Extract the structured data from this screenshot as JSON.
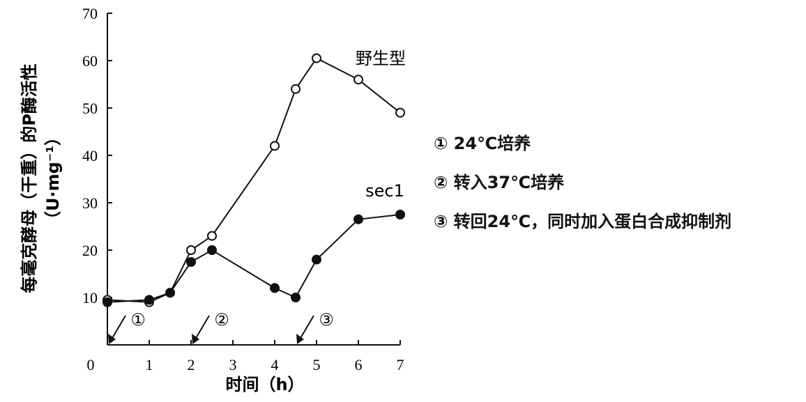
{
  "chart_data": {
    "type": "line",
    "xlabel": "时间（h）",
    "ylabel_line1": "每毫克酵母（干重）的P酶活性",
    "ylabel_line2": "（U·mg⁻¹）",
    "xlim": [
      0,
      7
    ],
    "ylim": [
      0,
      70
    ],
    "x_ticks": [
      "0",
      "1",
      "2",
      "3",
      "4",
      "5",
      "6",
      "7"
    ],
    "y_ticks": [
      "10",
      "20",
      "30",
      "40",
      "50",
      "60",
      "70"
    ],
    "grid": false,
    "series": [
      {
        "name": "野生型",
        "marker": "open-circle",
        "x": [
          0,
          1,
          1.5,
          2,
          2.5,
          4,
          4.5,
          5,
          6,
          7
        ],
        "y": [
          9.5,
          9,
          11,
          20,
          23,
          42,
          54,
          60.5,
          56,
          49
        ]
      },
      {
        "name": "sec1",
        "marker": "filled-circle",
        "x": [
          0,
          1,
          1.5,
          2,
          2.5,
          4,
          4.5,
          5,
          6,
          7
        ],
        "y": [
          9,
          9.5,
          11,
          17.5,
          20,
          12,
          10,
          18,
          26.5,
          27.5
        ]
      }
    ],
    "markers": [
      {
        "label": "①",
        "x": 0
      },
      {
        "label": "②",
        "x": 2
      },
      {
        "label": "③",
        "x": 4.5
      }
    ]
  },
  "legend": [
    "① 24℃培养",
    "② 转入37℃培养",
    "③ 转回24℃，同时加入蛋白合成抑制剂"
  ]
}
